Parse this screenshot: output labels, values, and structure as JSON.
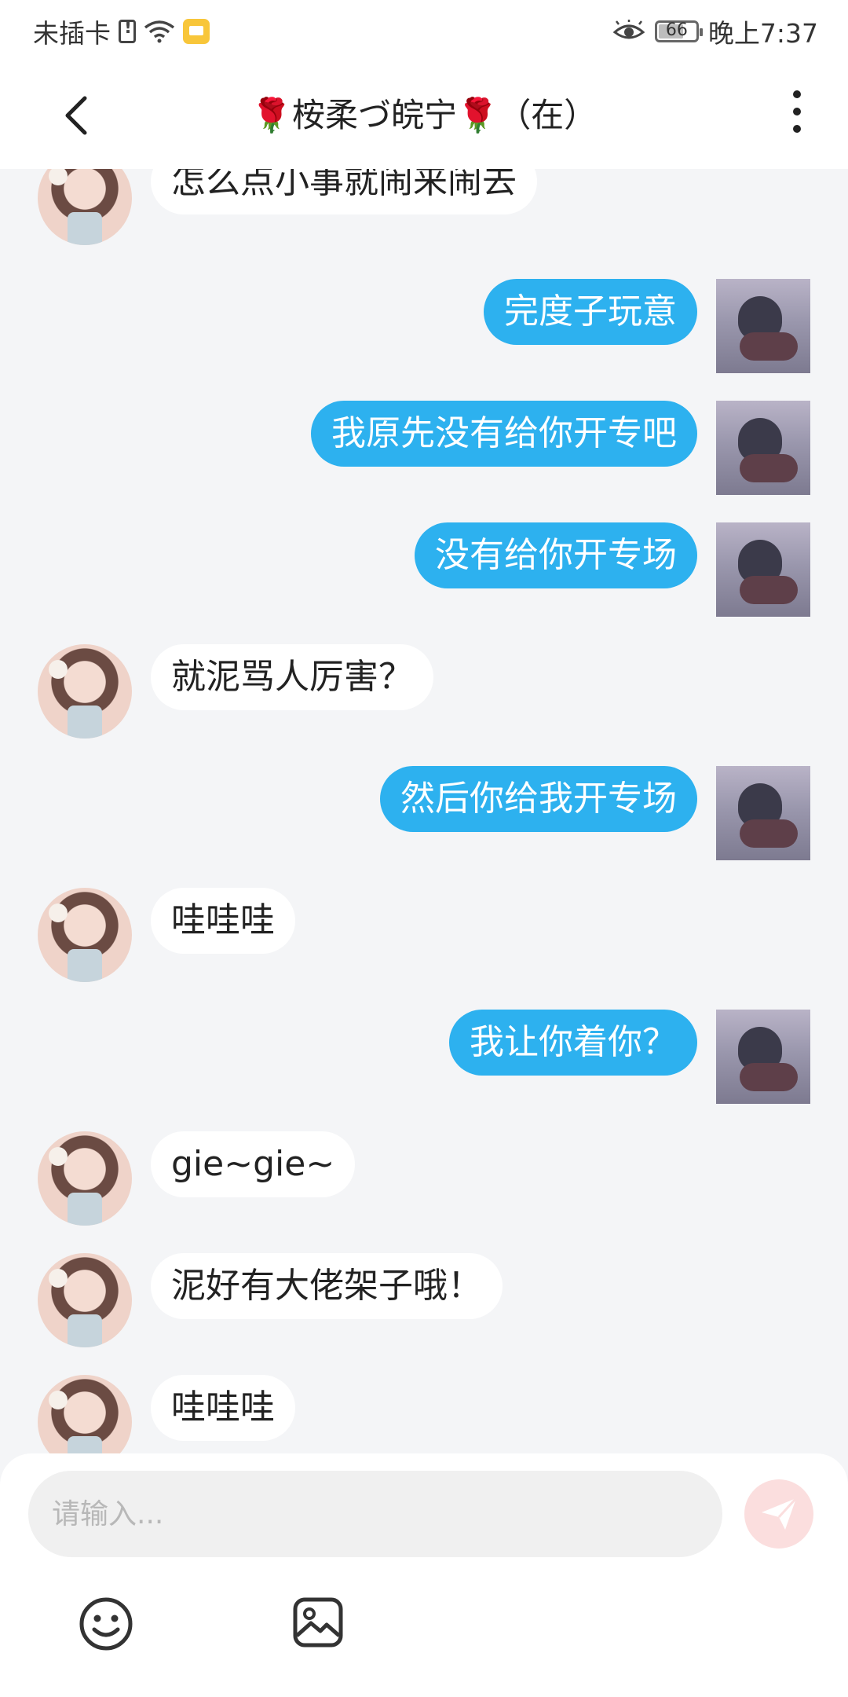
{
  "status_bar": {
    "carrier": "未插卡",
    "battery": "66",
    "time": "晚上7:37"
  },
  "header": {
    "title": "🌹桉柔づ皖宁🌹（在）"
  },
  "messages": [
    {
      "side": "peer",
      "text": "怎么点小事就闹来闹去"
    },
    {
      "side": "self",
      "text": "完度子玩意"
    },
    {
      "side": "self",
      "text": "我原先没有给你开专吧"
    },
    {
      "side": "self",
      "text": "没有给你开专场"
    },
    {
      "side": "peer",
      "text": "就泥骂人厉害？"
    },
    {
      "side": "self",
      "text": "然后你给我开专场"
    },
    {
      "side": "peer",
      "text": "哇哇哇"
    },
    {
      "side": "self",
      "text": "我让你着你？"
    },
    {
      "side": "peer",
      "text": "gie~gie~"
    },
    {
      "side": "peer",
      "text": "泥好有大佬架子哦！"
    },
    {
      "side": "peer",
      "text": "哇哇哇"
    }
  ],
  "composer": {
    "placeholder": "请输入..."
  },
  "colors": {
    "self_bubble": "#2db1ef",
    "peer_bubble": "#ffffff",
    "send_button": "#fbdede"
  }
}
